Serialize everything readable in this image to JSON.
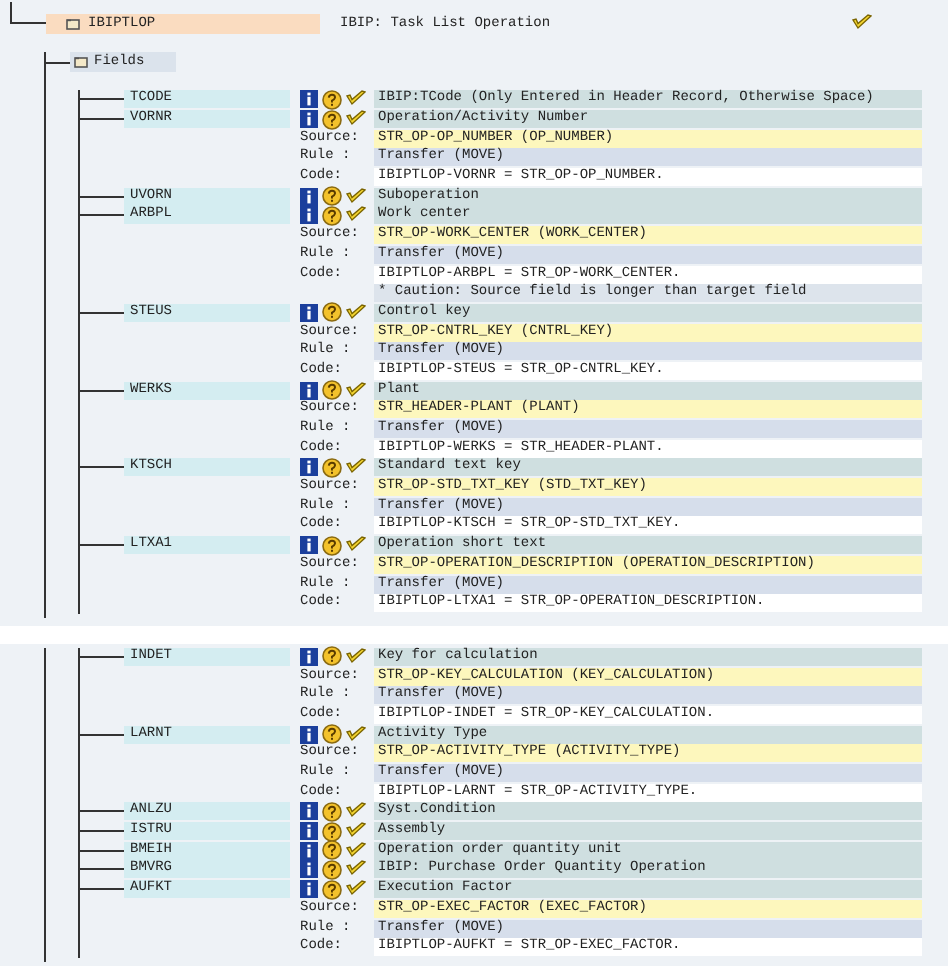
{
  "panels": [
    {
      "root": {
        "name": "IBIPTLOP",
        "description": "IBIP: Task List Operation"
      },
      "group": "Fields",
      "fields": [
        {
          "name": "TCODE",
          "description": "IBIP:TCode (Only Entered in Header Record, Otherwise Space)"
        },
        {
          "name": "VORNR",
          "description": "Operation/Activity Number",
          "details": [
            {
              "kind": "source",
              "label": "Source:",
              "value": "STR_OP-OP_NUMBER (OP_NUMBER)"
            },
            {
              "kind": "rule",
              "label": "Rule :",
              "value": "Transfer (MOVE)"
            },
            {
              "kind": "code",
              "label": "Code:",
              "value": "IBIPTLOP-VORNR = STR_OP-OP_NUMBER."
            }
          ]
        },
        {
          "name": "UVORN",
          "description": "Suboperation"
        },
        {
          "name": "ARBPL",
          "description": "Work center",
          "details": [
            {
              "kind": "source",
              "label": "Source:",
              "value": "STR_OP-WORK_CENTER (WORK_CENTER)"
            },
            {
              "kind": "rule",
              "label": "Rule :",
              "value": "Transfer (MOVE)"
            },
            {
              "kind": "code",
              "label": "Code:",
              "value": "IBIPTLOP-ARBPL = STR_OP-WORK_CENTER."
            },
            {
              "kind": "note",
              "value": "* Caution: Source field is longer than target field"
            }
          ]
        },
        {
          "name": "STEUS",
          "description": "Control key",
          "details": [
            {
              "kind": "source",
              "label": "Source:",
              "value": "STR_OP-CNTRL_KEY (CNTRL_KEY)"
            },
            {
              "kind": "rule",
              "label": "Rule :",
              "value": "Transfer (MOVE)"
            },
            {
              "kind": "code",
              "label": "Code:",
              "value": "IBIPTLOP-STEUS = STR_OP-CNTRL_KEY."
            }
          ]
        },
        {
          "name": "WERKS",
          "description": "Plant",
          "details": [
            {
              "kind": "source",
              "label": "Source:",
              "value": "STR_HEADER-PLANT (PLANT)"
            },
            {
              "kind": "rule",
              "label": "Rule :",
              "value": "Transfer (MOVE)"
            },
            {
              "kind": "code",
              "label": "Code:",
              "value": "IBIPTLOP-WERKS = STR_HEADER-PLANT."
            }
          ]
        },
        {
          "name": "KTSCH",
          "description": "Standard text key",
          "details": [
            {
              "kind": "source",
              "label": "Source:",
              "value": "STR_OP-STD_TXT_KEY (STD_TXT_KEY)"
            },
            {
              "kind": "rule",
              "label": "Rule :",
              "value": "Transfer (MOVE)"
            },
            {
              "kind": "code",
              "label": "Code:",
              "value": "IBIPTLOP-KTSCH = STR_OP-STD_TXT_KEY."
            }
          ]
        },
        {
          "name": "LTXA1",
          "description": "Operation short text",
          "details": [
            {
              "kind": "source",
              "label": "Source:",
              "value": "STR_OP-OPERATION_DESCRIPTION (OPERATION_DESCRIPTION)"
            },
            {
              "kind": "rule",
              "label": "Rule :",
              "value": "Transfer (MOVE)"
            },
            {
              "kind": "code",
              "label": "Code:",
              "value": "IBIPTLOP-LTXA1 = STR_OP-OPERATION_DESCRIPTION."
            }
          ]
        }
      ]
    },
    {
      "fields": [
        {
          "name": "INDET",
          "description": "Key for calculation",
          "details": [
            {
              "kind": "source",
              "label": "Source:",
              "value": "STR_OP-KEY_CALCULATION (KEY_CALCULATION)"
            },
            {
              "kind": "rule",
              "label": "Rule :",
              "value": "Transfer (MOVE)"
            },
            {
              "kind": "code",
              "label": "Code:",
              "value": "IBIPTLOP-INDET = STR_OP-KEY_CALCULATION."
            }
          ]
        },
        {
          "name": "LARNT",
          "description": "Activity Type",
          "details": [
            {
              "kind": "source",
              "label": "Source:",
              "value": "STR_OP-ACTIVITY_TYPE (ACTIVITY_TYPE)"
            },
            {
              "kind": "rule",
              "label": "Rule :",
              "value": "Transfer (MOVE)"
            },
            {
              "kind": "code",
              "label": "Code:",
              "value": "IBIPTLOP-LARNT = STR_OP-ACTIVITY_TYPE."
            }
          ]
        },
        {
          "name": "ANLZU",
          "description": "Syst.Condition"
        },
        {
          "name": "ISTRU",
          "description": "Assembly"
        },
        {
          "name": "BMEIH",
          "description": "Operation order quantity unit"
        },
        {
          "name": "BMVRG",
          "description": "IBIP: Purchase Order Quantity Operation"
        },
        {
          "name": "AUFKT",
          "description": "Execution Factor",
          "details": [
            {
              "kind": "source",
              "label": "Source:",
              "value": "STR_OP-EXEC_FACTOR (EXEC_FACTOR)"
            },
            {
              "kind": "rule",
              "label": "Rule :",
              "value": "Transfer (MOVE)"
            },
            {
              "kind": "code",
              "label": "Code:",
              "value": "IBIPTLOP-AUFKT = STR_OP-EXEC_FACTOR."
            }
          ]
        }
      ]
    }
  ]
}
